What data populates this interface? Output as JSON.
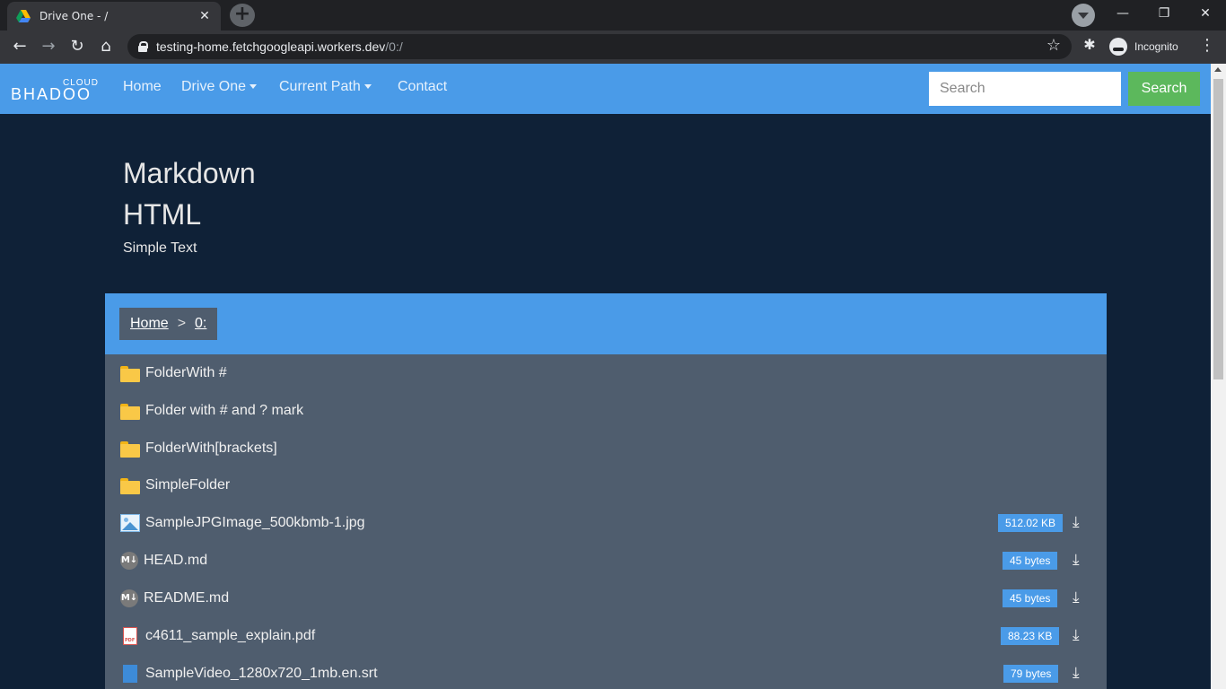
{
  "browser": {
    "tab_title": "Drive One - /",
    "tab_close": "✕",
    "new_tab": "+",
    "url_host": "testing-home.fetchgoogleapi.workers.dev",
    "url_path": "/0:/",
    "incognito_label": "Incognito",
    "controls": {
      "minimize": "—",
      "restore": "❐",
      "close": "✕"
    },
    "nav": {
      "back": "←",
      "forward": "→",
      "reload": "↻",
      "home": "⌂",
      "star": "☆",
      "extensions": "✱",
      "menu": "⋮"
    }
  },
  "navbar": {
    "logo_top": "CLOUD",
    "logo_main": "BHADOO",
    "links": [
      "Home",
      "Drive One",
      "Current Path",
      "Contact"
    ],
    "search_placeholder": "Search",
    "search_button": "Search",
    "colors": {
      "navbar": "#4a9be8",
      "search_button": "#5cb85c"
    }
  },
  "readme": {
    "heading1": "Markdown",
    "heading2": "HTML",
    "paragraph": "Simple Text"
  },
  "breadcrumb": {
    "home": "Home",
    "separator": ">",
    "current": "0:"
  },
  "files": [
    {
      "name": "FolderWith #",
      "type": "folder",
      "icon": "folder-icon"
    },
    {
      "name": "Folder with # and ? mark",
      "type": "folder",
      "icon": "folder-icon"
    },
    {
      "name": "FolderWith[brackets]",
      "type": "folder",
      "icon": "folder-icon"
    },
    {
      "name": "SimpleFolder",
      "type": "folder",
      "icon": "folder-icon"
    },
    {
      "name": "SampleJPGImage_500kbmb-1.jpg",
      "type": "image",
      "icon": "image-file-icon",
      "size": "512.02 KB"
    },
    {
      "name": "HEAD.md",
      "type": "markdown",
      "icon": "markdown-file-icon",
      "icon_text": "M↓",
      "size": "45 bytes"
    },
    {
      "name": "README.md",
      "type": "markdown",
      "icon": "markdown-file-icon",
      "icon_text": "M↓",
      "size": "45 bytes"
    },
    {
      "name": "c4611_sample_explain.pdf",
      "type": "pdf",
      "icon": "pdf-file-icon",
      "size": "88.23 KB"
    },
    {
      "name": "SampleVideo_1280x720_1mb.en.srt",
      "type": "subtitle",
      "icon": "subtitle-file-icon",
      "size": "79 bytes"
    }
  ]
}
